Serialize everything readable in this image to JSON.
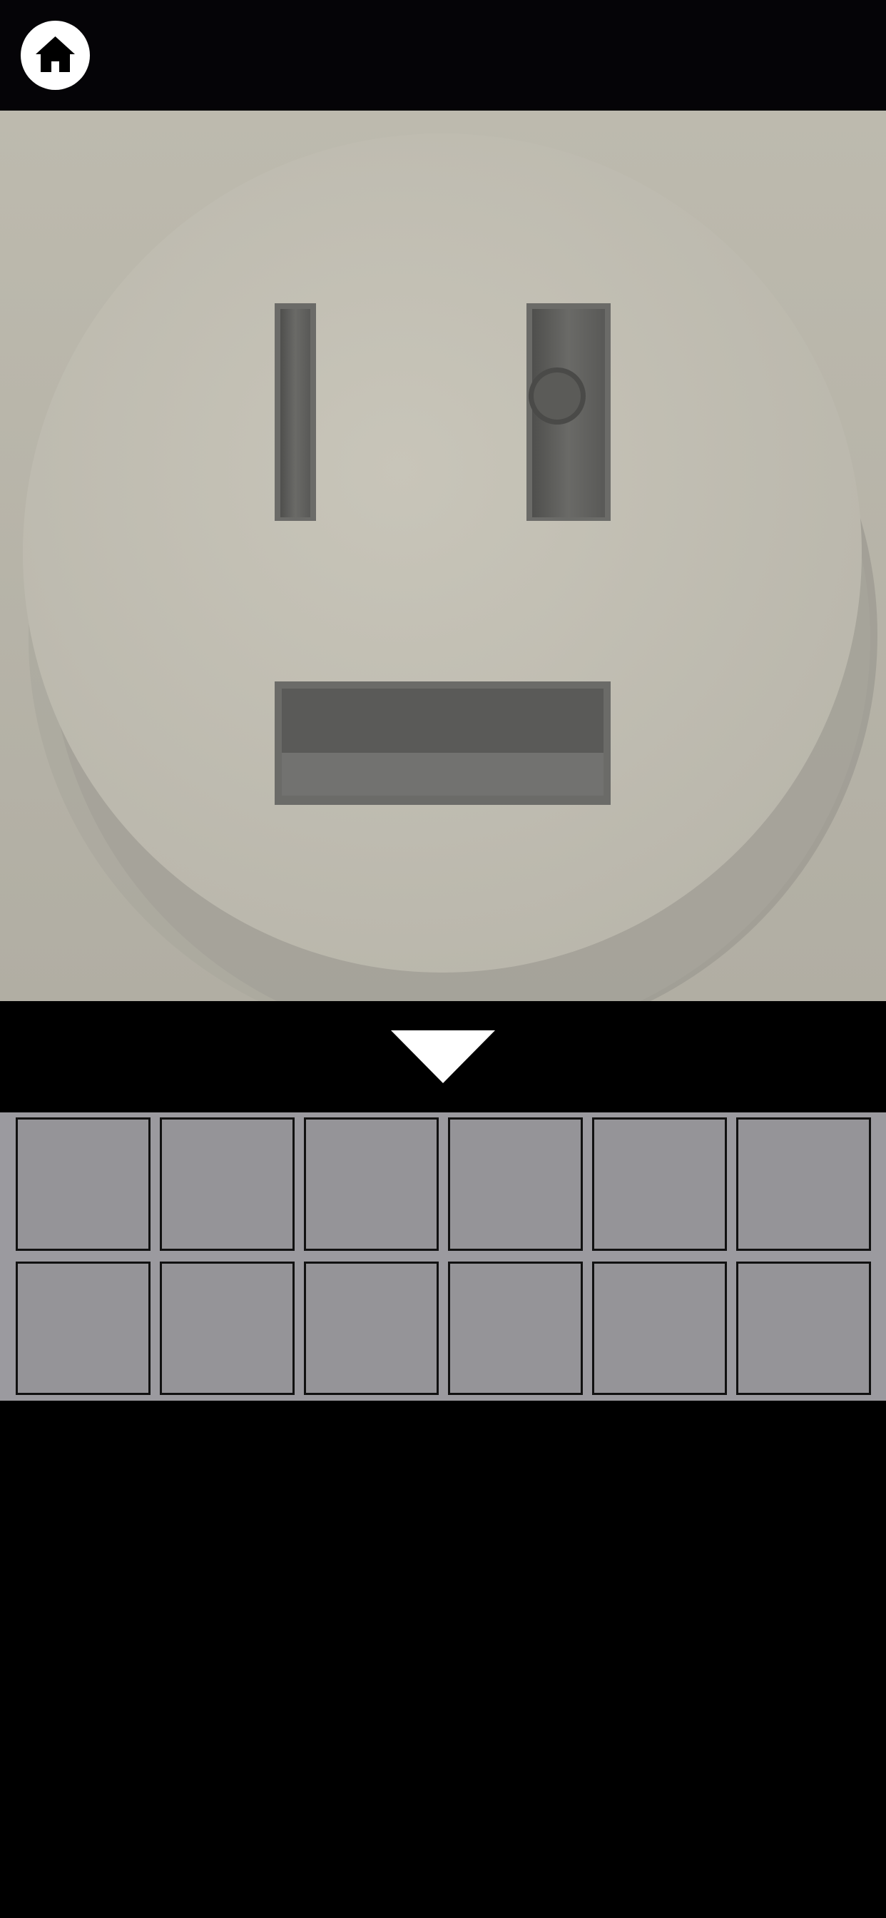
{
  "game": {
    "view": "outlet-closeup",
    "colors": {
      "background": "#000000",
      "scene_wall": "#b9b6aa",
      "outlet_face": "#c4c1b5",
      "slot_shadow": "#5e5e5b",
      "inventory_bg": "#9b9a9f",
      "inventory_slot": "#959498",
      "icon_white": "#ffffff"
    },
    "top_bar": {
      "home_button": {
        "icon": "home-icon"
      }
    },
    "navigation": {
      "down_arrow": {
        "icon": "down-triangle-icon"
      }
    },
    "inventory": {
      "rows": 2,
      "columns": 6,
      "slots": [
        {
          "item": null
        },
        {
          "item": null
        },
        {
          "item": null
        },
        {
          "item": null
        },
        {
          "item": null
        },
        {
          "item": null
        },
        {
          "item": null
        },
        {
          "item": null
        },
        {
          "item": null
        },
        {
          "item": null
        },
        {
          "item": null
        },
        {
          "item": null
        }
      ]
    }
  }
}
